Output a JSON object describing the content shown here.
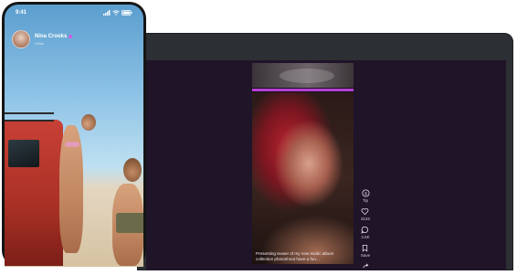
{
  "phone": {
    "status_time": "9:41",
    "profile_name": "Nina Crooks",
    "profile_sub": "Video"
  },
  "laptop": {
    "feed_caption": "Presenting teaser of my new exotic album collection photoshoot have a fun...",
    "actions": [
      {
        "icon": "tip-icon",
        "label": "Tip"
      },
      {
        "icon": "heart-icon",
        "label": "3132"
      },
      {
        "icon": "comment-icon",
        "label": "3.6K"
      },
      {
        "icon": "save-icon",
        "label": "Save"
      },
      {
        "icon": "share-icon",
        "label": ""
      }
    ]
  },
  "colors": {
    "accent": "#b73fd6",
    "screen_bg": "#1f1428",
    "verified": "#d35ce6"
  }
}
